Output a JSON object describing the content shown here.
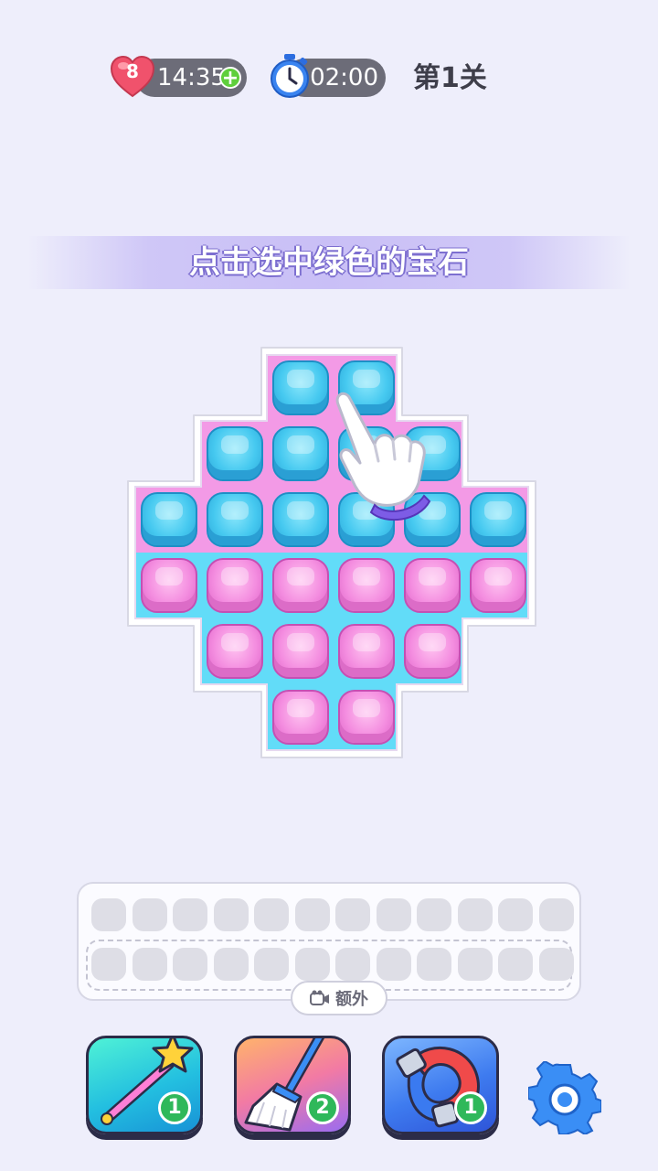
{
  "hud": {
    "lives": "8",
    "lives_timer": "14:35",
    "level_timer": "02:00",
    "level": "第1关"
  },
  "instruction": "点击选中绿色的宝石",
  "board": {
    "rows": [
      [
        "blue",
        "blue"
      ],
      [
        "blue",
        "blue",
        "blue",
        "blue"
      ],
      [
        "blue",
        "blue",
        "blue",
        "blue",
        "blue",
        "blue"
      ],
      [
        "pink",
        "pink",
        "pink",
        "pink",
        "pink",
        "pink"
      ],
      [
        "pink",
        "pink",
        "pink",
        "pink"
      ],
      [
        "pink",
        "pink"
      ]
    ]
  },
  "tray": {
    "extra_label": "额外"
  },
  "tools": {
    "wand": {
      "count": "1",
      "icon": "magic-wand-icon"
    },
    "broom": {
      "count": "2",
      "icon": "broom-icon"
    },
    "magnet": {
      "count": "1",
      "icon": "magnet-icon"
    }
  },
  "colors": {
    "background": "#eeeefb",
    "gem_blue": "#46c9f0",
    "gem_pink": "#f48ee0",
    "board_pink": "#f39ae6",
    "board_cyan": "#62dcf8"
  }
}
